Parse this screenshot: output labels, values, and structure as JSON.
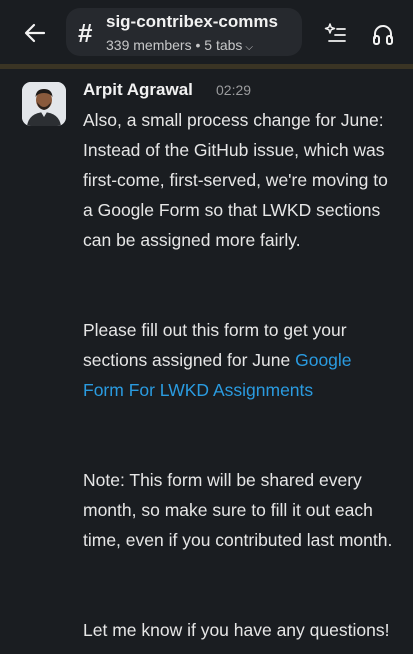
{
  "header": {
    "channel_name": "sig-contribex-comms",
    "channel_meta": "339 members • 5 tabs"
  },
  "message": {
    "author": "Arpit Agrawal",
    "time": "02:29",
    "para1": "Also, a small process change for June: Instead of the GitHub issue, which was first-come, first-served, we're moving to a Google Form so that LWKD sections can be assigned more fairly.",
    "para2": "Please fill out this form to get your sections assigned for June",
    "link_text": "Google Form For LWKD Assignments",
    "para3": "Note: This form will be shared every month, so make sure to fill it out each time, even if you contributed last month.",
    "para4": "Let me know if you have any questions!"
  },
  "colors": {
    "background": "#1a1d21",
    "link": "#2a9be0",
    "divider": "#3a3424"
  }
}
